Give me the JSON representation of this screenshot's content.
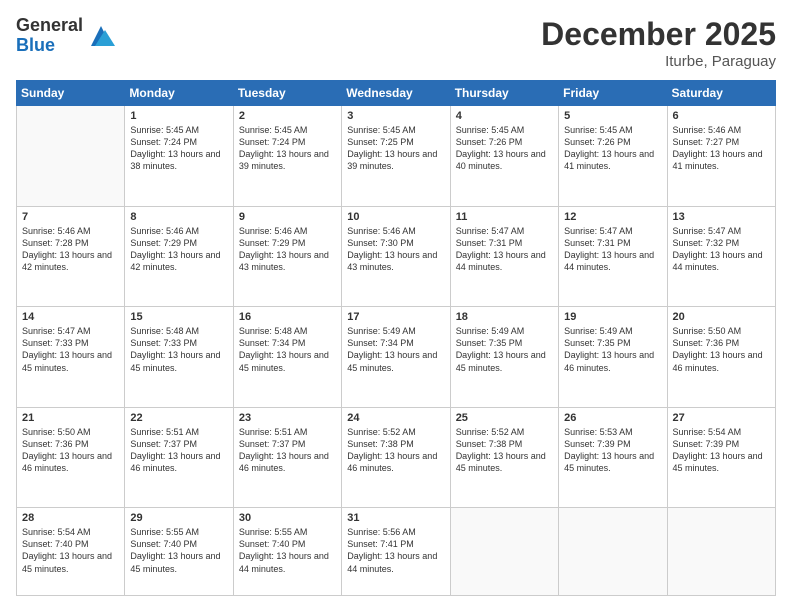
{
  "header": {
    "logo_general": "General",
    "logo_blue": "Blue",
    "month_title": "December 2025",
    "location": "Iturbe, Paraguay"
  },
  "weekdays": [
    "Sunday",
    "Monday",
    "Tuesday",
    "Wednesday",
    "Thursday",
    "Friday",
    "Saturday"
  ],
  "weeks": [
    [
      {
        "day": "",
        "sunrise": "",
        "sunset": "",
        "daylight": ""
      },
      {
        "day": "1",
        "sunrise": "Sunrise: 5:45 AM",
        "sunset": "Sunset: 7:24 PM",
        "daylight": "Daylight: 13 hours and 38 minutes."
      },
      {
        "day": "2",
        "sunrise": "Sunrise: 5:45 AM",
        "sunset": "Sunset: 7:24 PM",
        "daylight": "Daylight: 13 hours and 39 minutes."
      },
      {
        "day": "3",
        "sunrise": "Sunrise: 5:45 AM",
        "sunset": "Sunset: 7:25 PM",
        "daylight": "Daylight: 13 hours and 39 minutes."
      },
      {
        "day": "4",
        "sunrise": "Sunrise: 5:45 AM",
        "sunset": "Sunset: 7:26 PM",
        "daylight": "Daylight: 13 hours and 40 minutes."
      },
      {
        "day": "5",
        "sunrise": "Sunrise: 5:45 AM",
        "sunset": "Sunset: 7:26 PM",
        "daylight": "Daylight: 13 hours and 41 minutes."
      },
      {
        "day": "6",
        "sunrise": "Sunrise: 5:46 AM",
        "sunset": "Sunset: 7:27 PM",
        "daylight": "Daylight: 13 hours and 41 minutes."
      }
    ],
    [
      {
        "day": "7",
        "sunrise": "Sunrise: 5:46 AM",
        "sunset": "Sunset: 7:28 PM",
        "daylight": "Daylight: 13 hours and 42 minutes."
      },
      {
        "day": "8",
        "sunrise": "Sunrise: 5:46 AM",
        "sunset": "Sunset: 7:29 PM",
        "daylight": "Daylight: 13 hours and 42 minutes."
      },
      {
        "day": "9",
        "sunrise": "Sunrise: 5:46 AM",
        "sunset": "Sunset: 7:29 PM",
        "daylight": "Daylight: 13 hours and 43 minutes."
      },
      {
        "day": "10",
        "sunrise": "Sunrise: 5:46 AM",
        "sunset": "Sunset: 7:30 PM",
        "daylight": "Daylight: 13 hours and 43 minutes."
      },
      {
        "day": "11",
        "sunrise": "Sunrise: 5:47 AM",
        "sunset": "Sunset: 7:31 PM",
        "daylight": "Daylight: 13 hours and 44 minutes."
      },
      {
        "day": "12",
        "sunrise": "Sunrise: 5:47 AM",
        "sunset": "Sunset: 7:31 PM",
        "daylight": "Daylight: 13 hours and 44 minutes."
      },
      {
        "day": "13",
        "sunrise": "Sunrise: 5:47 AM",
        "sunset": "Sunset: 7:32 PM",
        "daylight": "Daylight: 13 hours and 44 minutes."
      }
    ],
    [
      {
        "day": "14",
        "sunrise": "Sunrise: 5:47 AM",
        "sunset": "Sunset: 7:33 PM",
        "daylight": "Daylight: 13 hours and 45 minutes."
      },
      {
        "day": "15",
        "sunrise": "Sunrise: 5:48 AM",
        "sunset": "Sunset: 7:33 PM",
        "daylight": "Daylight: 13 hours and 45 minutes."
      },
      {
        "day": "16",
        "sunrise": "Sunrise: 5:48 AM",
        "sunset": "Sunset: 7:34 PM",
        "daylight": "Daylight: 13 hours and 45 minutes."
      },
      {
        "day": "17",
        "sunrise": "Sunrise: 5:49 AM",
        "sunset": "Sunset: 7:34 PM",
        "daylight": "Daylight: 13 hours and 45 minutes."
      },
      {
        "day": "18",
        "sunrise": "Sunrise: 5:49 AM",
        "sunset": "Sunset: 7:35 PM",
        "daylight": "Daylight: 13 hours and 45 minutes."
      },
      {
        "day": "19",
        "sunrise": "Sunrise: 5:49 AM",
        "sunset": "Sunset: 7:35 PM",
        "daylight": "Daylight: 13 hours and 46 minutes."
      },
      {
        "day": "20",
        "sunrise": "Sunrise: 5:50 AM",
        "sunset": "Sunset: 7:36 PM",
        "daylight": "Daylight: 13 hours and 46 minutes."
      }
    ],
    [
      {
        "day": "21",
        "sunrise": "Sunrise: 5:50 AM",
        "sunset": "Sunset: 7:36 PM",
        "daylight": "Daylight: 13 hours and 46 minutes."
      },
      {
        "day": "22",
        "sunrise": "Sunrise: 5:51 AM",
        "sunset": "Sunset: 7:37 PM",
        "daylight": "Daylight: 13 hours and 46 minutes."
      },
      {
        "day": "23",
        "sunrise": "Sunrise: 5:51 AM",
        "sunset": "Sunset: 7:37 PM",
        "daylight": "Daylight: 13 hours and 46 minutes."
      },
      {
        "day": "24",
        "sunrise": "Sunrise: 5:52 AM",
        "sunset": "Sunset: 7:38 PM",
        "daylight": "Daylight: 13 hours and 46 minutes."
      },
      {
        "day": "25",
        "sunrise": "Sunrise: 5:52 AM",
        "sunset": "Sunset: 7:38 PM",
        "daylight": "Daylight: 13 hours and 45 minutes."
      },
      {
        "day": "26",
        "sunrise": "Sunrise: 5:53 AM",
        "sunset": "Sunset: 7:39 PM",
        "daylight": "Daylight: 13 hours and 45 minutes."
      },
      {
        "day": "27",
        "sunrise": "Sunrise: 5:54 AM",
        "sunset": "Sunset: 7:39 PM",
        "daylight": "Daylight: 13 hours and 45 minutes."
      }
    ],
    [
      {
        "day": "28",
        "sunrise": "Sunrise: 5:54 AM",
        "sunset": "Sunset: 7:40 PM",
        "daylight": "Daylight: 13 hours and 45 minutes."
      },
      {
        "day": "29",
        "sunrise": "Sunrise: 5:55 AM",
        "sunset": "Sunset: 7:40 PM",
        "daylight": "Daylight: 13 hours and 45 minutes."
      },
      {
        "day": "30",
        "sunrise": "Sunrise: 5:55 AM",
        "sunset": "Sunset: 7:40 PM",
        "daylight": "Daylight: 13 hours and 44 minutes."
      },
      {
        "day": "31",
        "sunrise": "Sunrise: 5:56 AM",
        "sunset": "Sunset: 7:41 PM",
        "daylight": "Daylight: 13 hours and 44 minutes."
      },
      {
        "day": "",
        "sunrise": "",
        "sunset": "",
        "daylight": ""
      },
      {
        "day": "",
        "sunrise": "",
        "sunset": "",
        "daylight": ""
      },
      {
        "day": "",
        "sunrise": "",
        "sunset": "",
        "daylight": ""
      }
    ]
  ]
}
